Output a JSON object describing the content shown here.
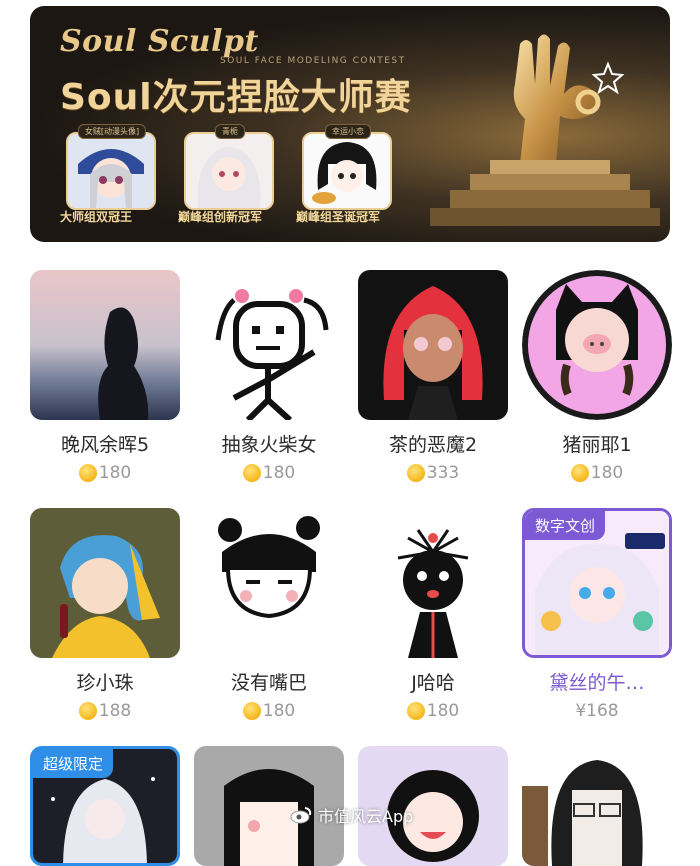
{
  "banner": {
    "script_logo": "Soul Sculpt",
    "subtitle": "SOUL FACE MODELING CONTEST",
    "title": "Soul次元捏脸大师赛",
    "prizes": [
      {
        "tag": "女贼[动漫头像]",
        "label": "大师组双冠王"
      },
      {
        "tag": "青栀",
        "label": "巅峰组创新冠军"
      },
      {
        "tag": "幸运小恋",
        "label": "巅峰组圣诞冠军"
      }
    ]
  },
  "products": [
    {
      "name": "晚风余晖5",
      "price": "180"
    },
    {
      "name": "抽象火柴女",
      "price": "180"
    },
    {
      "name": "茶的恶魔2",
      "price": "333"
    },
    {
      "name": "猪丽耶1",
      "price": "180"
    },
    {
      "name": "珍小珠",
      "price": "188"
    },
    {
      "name": "没有嘴巴",
      "price": "180"
    },
    {
      "name": "J哈哈",
      "price": "180"
    },
    {
      "name": "黛丝的午…",
      "price": "¥168",
      "badge": "数字文创",
      "highlight_color": "#7c5ad6"
    },
    {
      "name": "",
      "price": "",
      "badge": "超级限定"
    },
    {
      "name": "",
      "price": ""
    },
    {
      "name": "",
      "price": ""
    },
    {
      "name": "",
      "price": ""
    }
  ],
  "watermark": "市值风云App",
  "colors": {
    "accent_purple": "#7c5ad6",
    "coin": "#f5b71c",
    "price_gray": "#9a9a9a"
  }
}
